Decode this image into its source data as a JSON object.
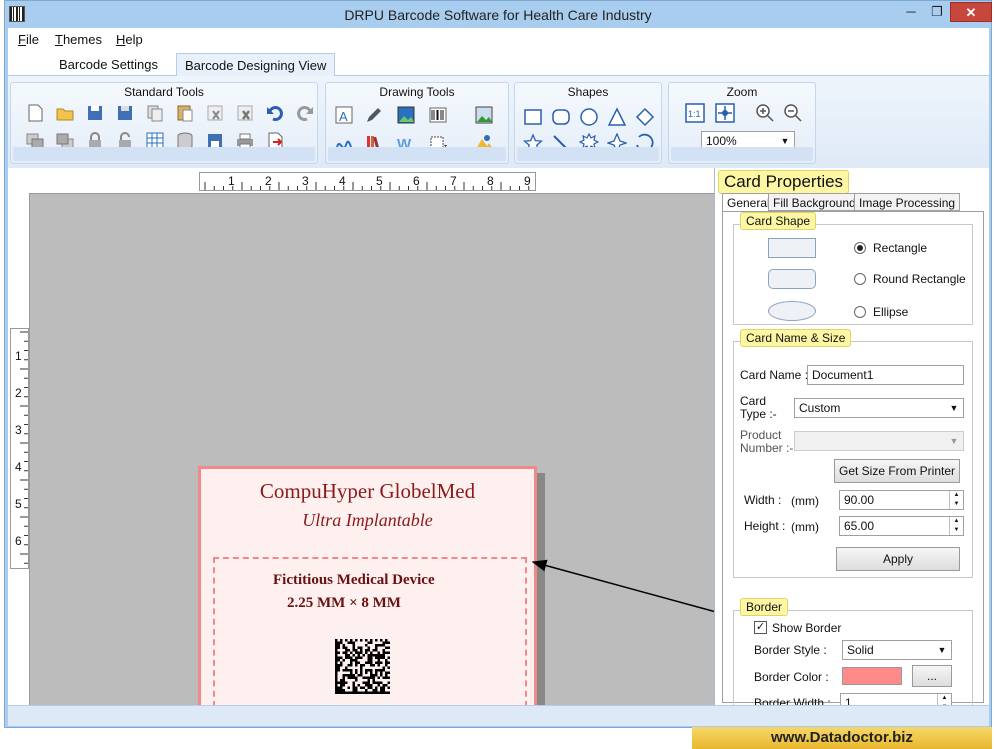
{
  "window": {
    "title": "DRPU Barcode Software for Health Care Industry",
    "min_glyph": "─",
    "max_glyph": "❐",
    "close_glyph": "✕"
  },
  "menu": [
    "File",
    "Themes",
    "Help"
  ],
  "tabs": {
    "settings": "Barcode Settings",
    "designing": "Barcode Designing View"
  },
  "ribbon": {
    "standard": "Standard Tools",
    "drawing": "Drawing Tools",
    "shapes": "Shapes",
    "zoom": "Zoom",
    "zoom_value": "100%"
  },
  "ruler": {
    "h": [
      "1",
      "2",
      "3",
      "4",
      "5",
      "6",
      "7",
      "8",
      "9"
    ],
    "v": [
      "1",
      "2",
      "3",
      "4",
      "5",
      "6"
    ]
  },
  "card": {
    "company": "CompuHyper GlobelMed",
    "subtitle": "Ultra Implantable",
    "device": "Fictitious Medical Device",
    "size": "2.25 MM × 8 MM"
  },
  "props": {
    "title": "Card Properties",
    "tabs": [
      "General",
      "Fill Background",
      "Image Processing"
    ],
    "shape": {
      "title": "Card Shape",
      "rect": "Rectangle",
      "round": "Round Rectangle",
      "ellipse": "Ellipse"
    },
    "name_size": {
      "title": "Card  Name & Size",
      "name_label": "Card Name :",
      "name_value": "Document1",
      "type_label": "Card\nType :-",
      "type_value": "Custom",
      "product_label": "Product\nNumber :-",
      "get_size": "Get Size From Printer",
      "width_label": "Width :",
      "unit": "(mm)",
      "width_value": "90.00",
      "height_label": "Height :",
      "height_value": "65.00",
      "apply": "Apply"
    },
    "border": {
      "title": "Border",
      "show": "Show Border",
      "style_label": "Border Style :",
      "style_value": "Solid",
      "color_label": "Border Color :",
      "color": "#ff8a8a",
      "dots": "...",
      "width_label": "Border Width :",
      "width_value": "1"
    }
  },
  "colors": {
    "card_border": "#f08a8a",
    "card_text": "#8b1a1a"
  },
  "watermark": "www.Datadoctor.biz"
}
